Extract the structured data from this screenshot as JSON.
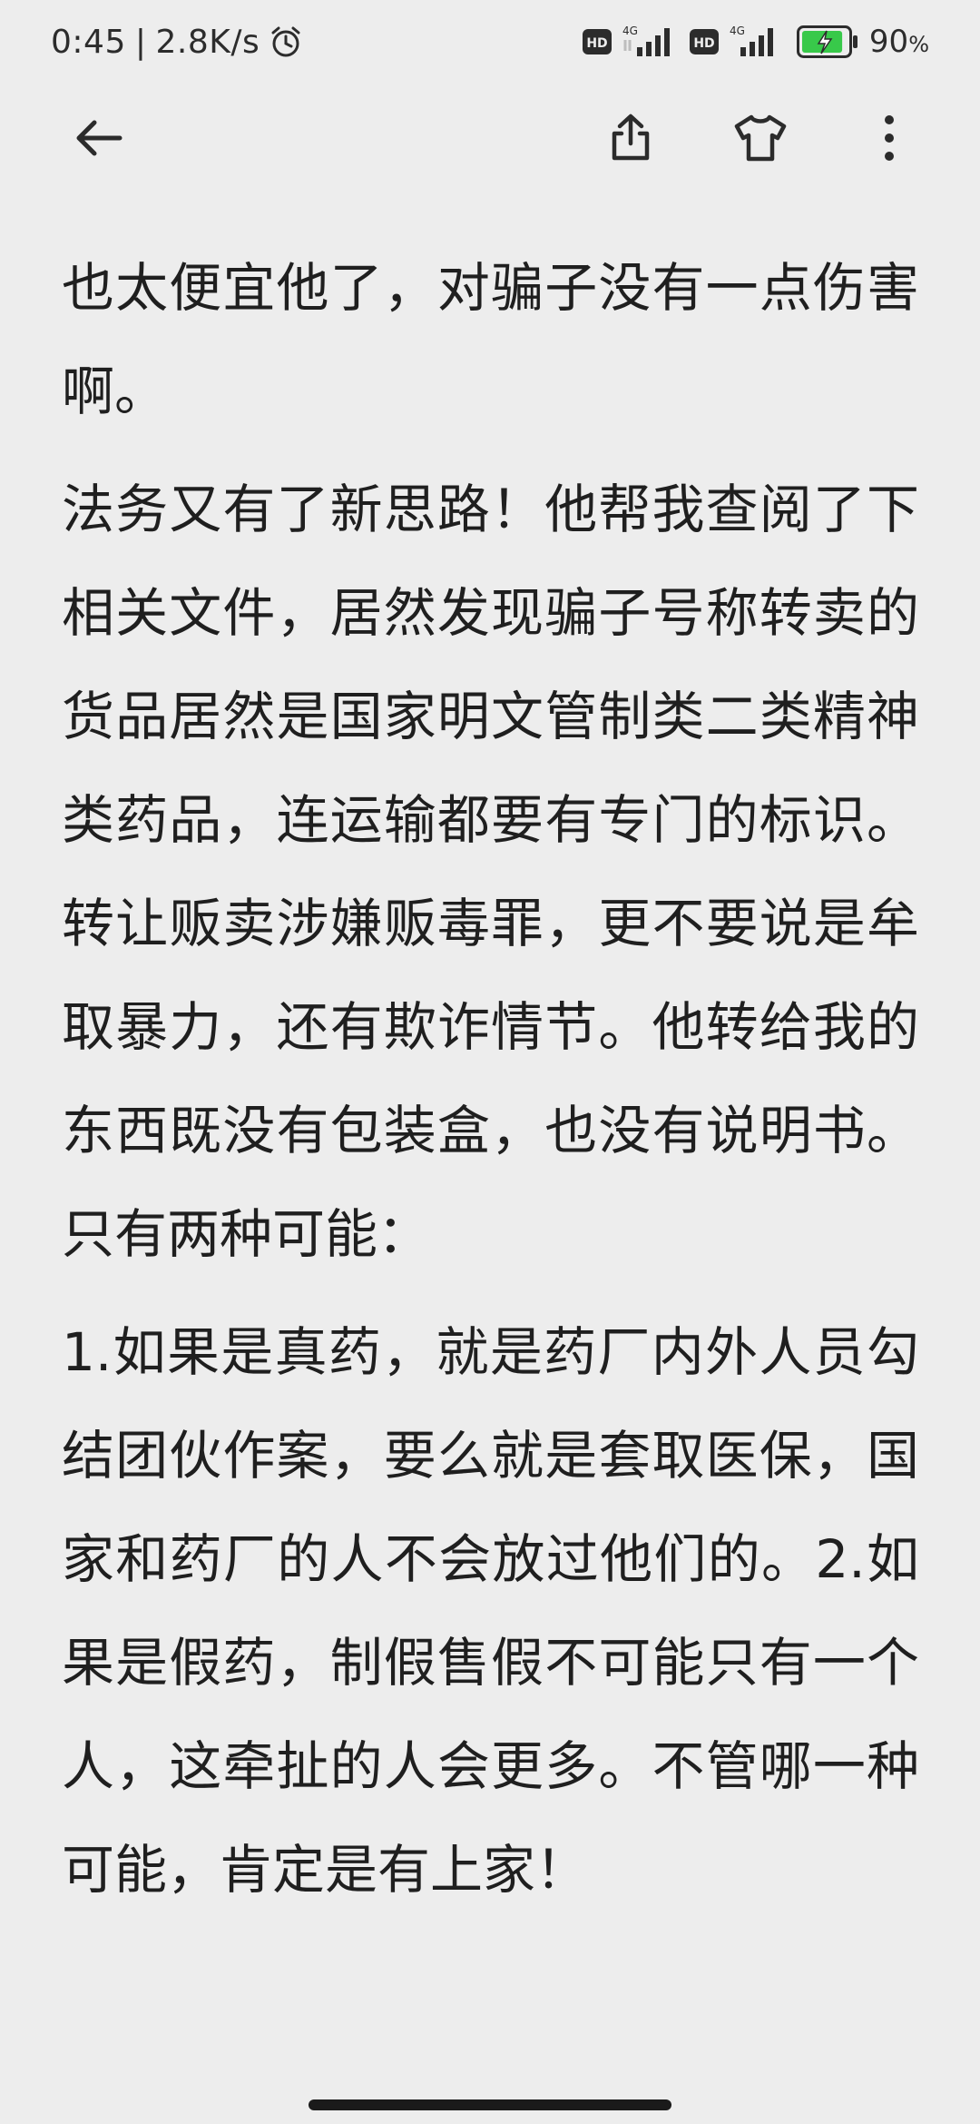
{
  "status_bar": {
    "time": "0:45",
    "separator": "|",
    "network_speed": "2.8K/s",
    "alarm_icon": "alarm-clock-icon",
    "hd_label_1": "HD",
    "net_label_1": "4G",
    "hd_label_2": "HD",
    "net_label_2": "4G",
    "battery_percent": "90",
    "battery_unit": "%",
    "battery_level": 0.9,
    "battery_color": "#38c94a"
  },
  "toolbar": {
    "back_icon": "back-arrow-icon",
    "share_icon": "share-icon",
    "theme_icon": "tshirt-icon",
    "more_icon": "more-vertical-icon"
  },
  "article": {
    "paragraphs": [
      "也太便宜他了，对骗子没有一点伤害啊。",
      "法务又有了新思路！他帮我查阅了下相关文件，居然发现骗子号称转卖的货品居然是国家明文管制类二类精神类药品，连运输都要有专门的标识。转让贩卖涉嫌贩毒罪，更不要说是牟取暴力，还有欺诈情节。他转给我的东西既没有包装盒，也没有说明书。只有两种可能：",
      "1.如果是真药，就是药厂内外人员勾结团伙作案，要么就是套取医保，国家和药厂的人不会放过他们的。2.如果是假药，制假售假不可能只有一个人，这牵扯的人会更多。不管哪一种可能，肯定是有上家！"
    ]
  }
}
